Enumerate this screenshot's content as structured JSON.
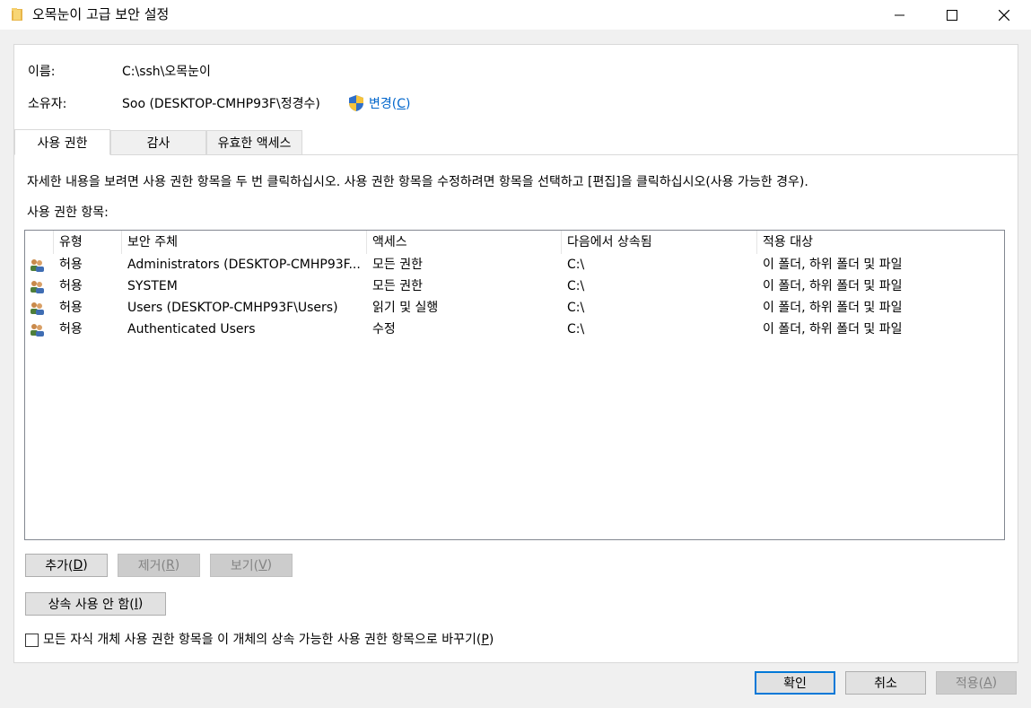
{
  "window": {
    "title": "오목눈이 고급 보안 설정",
    "icon": "folder-icon"
  },
  "info": {
    "name_label": "이름:",
    "name_value": "C:\\ssh\\오목눈이",
    "owner_label": "소유자:",
    "owner_value": "Soo (DESKTOP-CMHP93F\\정경수)",
    "change_label_prefix": "변경(",
    "change_label_key": "C",
    "change_label_suffix": ")"
  },
  "tabs": [
    {
      "label": "사용 권한",
      "active": true
    },
    {
      "label": "감사",
      "active": false
    },
    {
      "label": "유효한 액세스",
      "active": false
    }
  ],
  "instructions": "자세한 내용을 보려면 사용 권한 항목을 두 번 클릭하십시오. 사용 권한 항목을 수정하려면 항목을 선택하고 [편집]을 클릭하십시오(사용 가능한 경우).",
  "list_label": "사용 권한 항목:",
  "columns": [
    "유형",
    "보안 주체",
    "액세스",
    "다음에서 상속됨",
    "적용 대상"
  ],
  "rows": [
    {
      "type": "허용",
      "principal": "Administrators (DESKTOP-CMHP93F...",
      "access": "모든 권한",
      "inherited": "C:\\",
      "applies": "이 폴더, 하위 폴더 및 파일"
    },
    {
      "type": "허용",
      "principal": "SYSTEM",
      "access": "모든 권한",
      "inherited": "C:\\",
      "applies": "이 폴더, 하위 폴더 및 파일"
    },
    {
      "type": "허용",
      "principal": "Users (DESKTOP-CMHP93F\\Users)",
      "access": "읽기 및 실행",
      "inherited": "C:\\",
      "applies": "이 폴더, 하위 폴더 및 파일"
    },
    {
      "type": "허용",
      "principal": "Authenticated Users",
      "access": "수정",
      "inherited": "C:\\",
      "applies": "이 폴더, 하위 폴더 및 파일"
    }
  ],
  "buttons": {
    "add": {
      "text": "추가(",
      "key": "D",
      "end": ")"
    },
    "remove": {
      "text": "제거(",
      "key": "R",
      "end": ")"
    },
    "view": {
      "text": "보기(",
      "key": "V",
      "end": ")"
    },
    "disable_inheritance": {
      "text": "상속 사용 안 함(",
      "key": "I",
      "end": ")"
    },
    "ok": "확인",
    "cancel": "취소",
    "apply": {
      "text": "적용(",
      "key": "A",
      "end": ")"
    }
  },
  "replace_checkbox": {
    "text": "모든 자식 개체 사용 권한 항목을 이 개체의 상속 가능한 사용 권한 항목으로 바꾸기(",
    "key": "P",
    "end": ")",
    "checked": false
  },
  "colors": {
    "accent": "#0078d7",
    "link": "#0066cc"
  }
}
